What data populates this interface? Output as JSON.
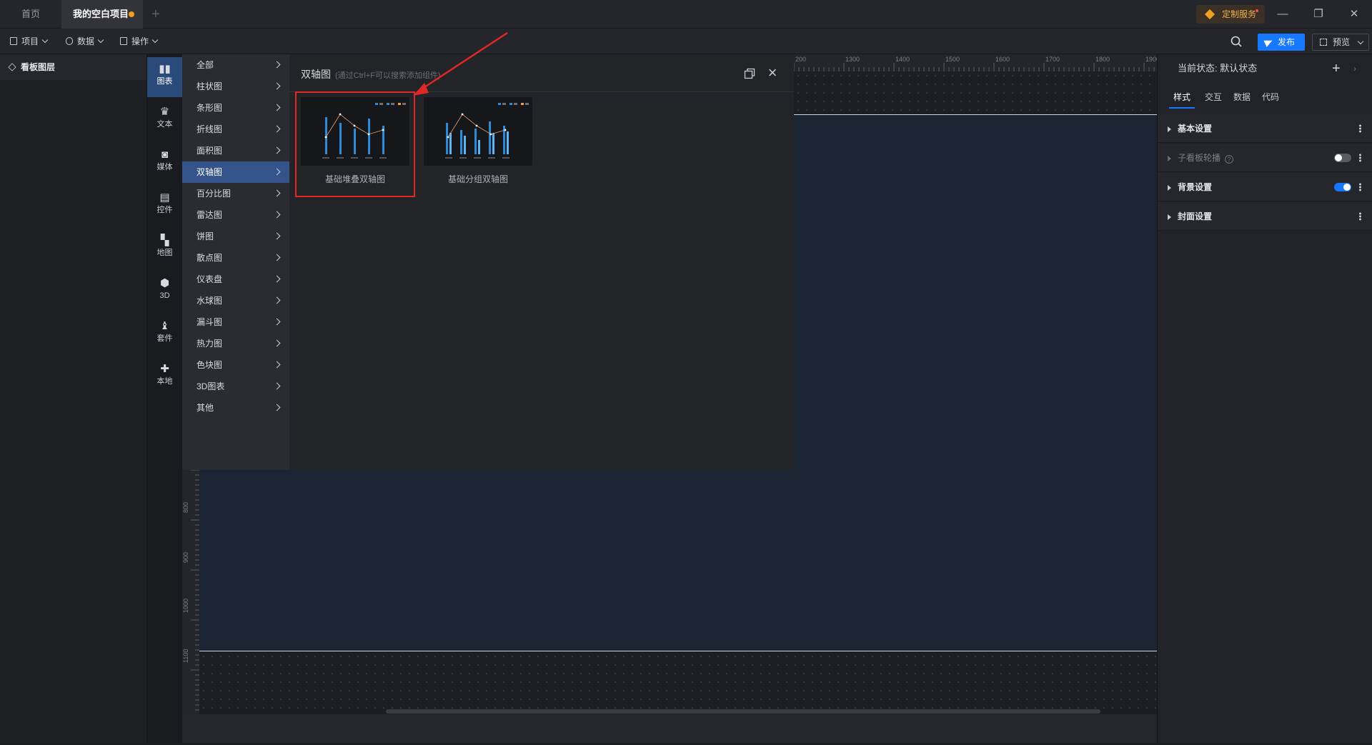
{
  "tabs": {
    "home": "首页",
    "active": "我的空白项目",
    "custom_service": "定制服务"
  },
  "toolbar": {
    "project": "项目",
    "data": "数据",
    "operate": "操作",
    "publish": "发布",
    "preview": "预览"
  },
  "layer_panel": {
    "title": "看板图层"
  },
  "categories": [
    {
      "label": "图表",
      "icon": "bar-chart-icon"
    },
    {
      "label": "文本",
      "icon": "crown-icon"
    },
    {
      "label": "媒体",
      "icon": "camera-icon"
    },
    {
      "label": "控件",
      "icon": "control-icon"
    },
    {
      "label": "地图",
      "icon": "map-icon"
    },
    {
      "label": "3D",
      "icon": "cube-icon"
    },
    {
      "label": "套件",
      "icon": "shirt-icon"
    },
    {
      "label": "本地",
      "icon": "puzzle-icon"
    }
  ],
  "chart_types": [
    "全部",
    "柱状图",
    "条形图",
    "折线图",
    "面积图",
    "双轴图",
    "百分比图",
    "雷达图",
    "饼图",
    "散点图",
    "仪表盘",
    "水球图",
    "漏斗图",
    "热力图",
    "色块图",
    "3D图表",
    "其他"
  ],
  "active_chart_type": "双轴图",
  "component_panel": {
    "title": "双轴图",
    "hint": "(通过Ctrl+F可以搜索添加组件)",
    "cards": [
      {
        "name": "基础堆叠双轴图"
      },
      {
        "name": "基础分组双轴图"
      }
    ]
  },
  "ruler": {
    "top_ticks": [
      "200",
      "1300",
      "1400",
      "1500",
      "1600",
      "1700",
      "1800",
      "1900"
    ],
    "left_ticks": [
      "800",
      "900",
      "1000",
      "1100"
    ]
  },
  "properties": {
    "state_label": "当前状态: 默认状态",
    "tabs": [
      "样式",
      "交互",
      "数据",
      "代码"
    ],
    "sections": [
      {
        "label": "基本设置"
      },
      {
        "label": "子看板轮播"
      },
      {
        "label": "背景设置"
      },
      {
        "label": "封面设置"
      }
    ]
  },
  "colors": {
    "accent": "#1677ff",
    "selection": "#e02828",
    "active_type": "#33538a",
    "active_category": "#2a4a7a"
  }
}
